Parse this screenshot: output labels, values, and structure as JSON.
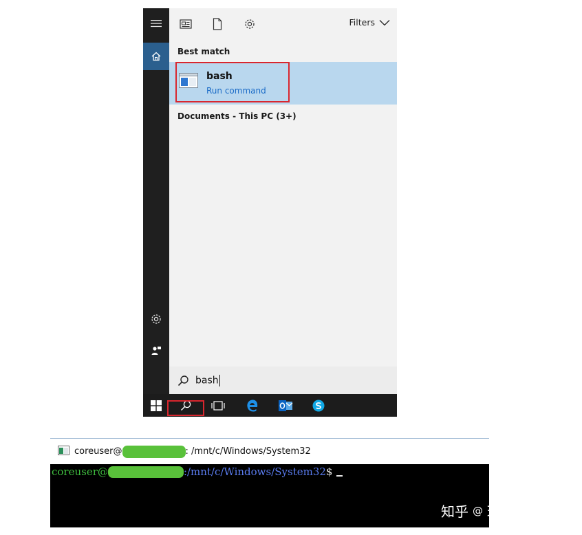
{
  "start_menu": {
    "toolbar": {
      "filters_label": "Filters",
      "icons": [
        "news-icon",
        "document-icon",
        "settings-gear-icon"
      ]
    },
    "left_rail": [
      "hamburger-menu-icon",
      "home-icon",
      "settings-gear-icon",
      "feedback-icon"
    ],
    "best_match_header": "Best match",
    "best_match": {
      "title": "bash",
      "subtitle": "Run command"
    },
    "documents_header": "Documents - This PC (3+)",
    "search": {
      "value": "bash"
    }
  },
  "taskbar": {
    "items": [
      "windows-start-icon",
      "search-icon",
      "task-view-icon",
      "edge-icon",
      "outlook-icon",
      "skype-icon"
    ]
  },
  "terminal": {
    "title_user": "coreuser@",
    "title_path": ": /mnt/c/Windows/System32",
    "prompt_user": "coreuser@",
    "prompt_path": ":/mnt/c/Windows/System32",
    "prompt_symbol": "$"
  },
  "watermark": {
    "site": "知乎",
    "separator": "@",
    "author": "琉璃康康"
  },
  "colors": {
    "rail": "#1f1f1f",
    "home_active": "#2b5f8e",
    "best_match_bg": "#b9d7ee",
    "highlight_red": "#d9262e",
    "link_blue": "#1a6bc7",
    "redaction_green": "#59c13a",
    "prompt_green": "#3fbf3f",
    "prompt_blue": "#5a7cf0"
  }
}
